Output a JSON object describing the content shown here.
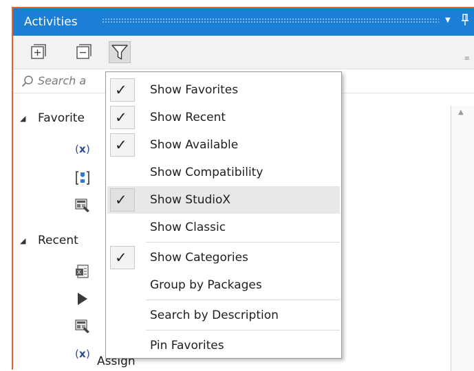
{
  "window": {
    "title": "Activities",
    "pin_glyph": "↓",
    "pin_icon": "pin-icon",
    "menu_glyph": "▼",
    "accent": "#1b7fd6",
    "frame_color": "#e8602c"
  },
  "toolbar": {
    "expand_all_icon": "expand-all-icon",
    "collapse_all_icon": "collapse-all-icon",
    "filter_icon": "filter-icon",
    "overflow": "≡"
  },
  "search": {
    "placeholder": "Search a",
    "icon": "search-icon"
  },
  "tree": {
    "favorites_label": "Favorite",
    "recent_label": "Recent",
    "recent_last_item": "Assign"
  },
  "menu": {
    "items": [
      {
        "label": "Show Favorites",
        "checked": true
      },
      {
        "label": "Show Recent",
        "checked": true
      },
      {
        "label": "Show Available",
        "checked": true
      },
      {
        "label": "Show Compatibility",
        "checked": false
      },
      {
        "label": "Show StudioX",
        "checked": true,
        "highlighted": true
      },
      {
        "label": "Show Classic",
        "checked": false
      },
      {
        "label": "Show Categories",
        "checked": true
      },
      {
        "label": "Group by Packages",
        "checked": false
      },
      {
        "label": "Search by Description",
        "checked": false
      },
      {
        "label": "Pin Favorites",
        "checked": false
      }
    ],
    "check_glyph": "✓"
  }
}
